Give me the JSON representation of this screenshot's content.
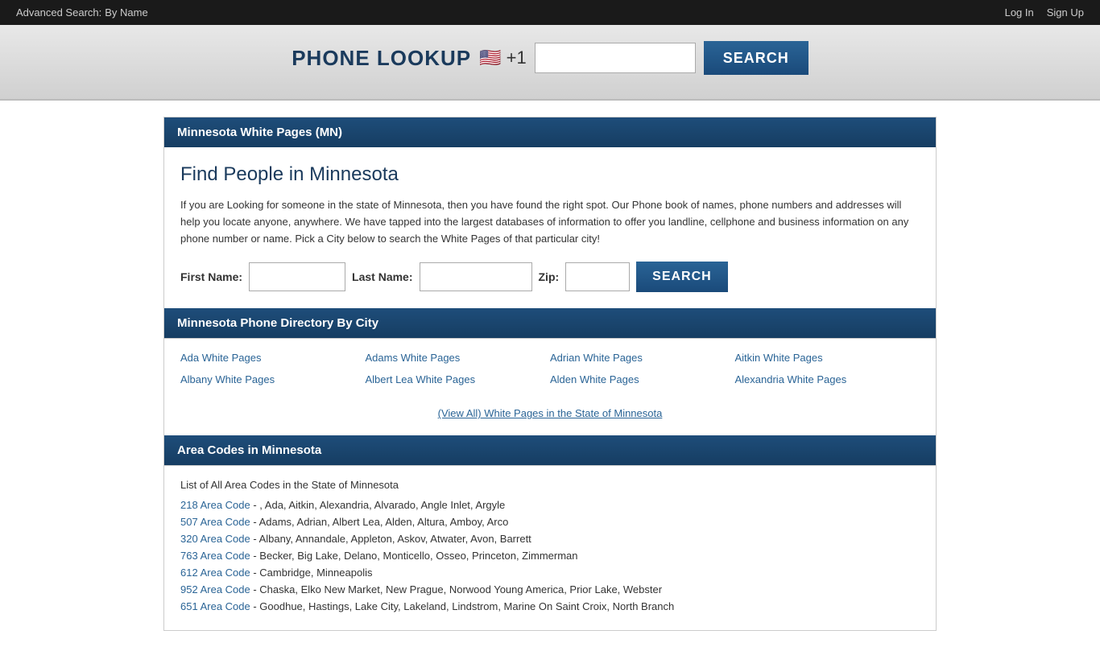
{
  "topBar": {
    "advancedSearch": "Advanced Search:",
    "byNameLabel": "By Name",
    "loginLabel": "Log In",
    "signupLabel": "Sign Up"
  },
  "phoneLookup": {
    "title": "PHONE LOOKUP",
    "flag": "🇺🇸",
    "countryCode": "+1",
    "inputPlaceholder": "",
    "searchLabel": "SEARCH"
  },
  "mainSection": {
    "headerTitle": "Minnesota White Pages (MN)",
    "findPeopleTitle": "Find People in Minnesota",
    "description": "If you are Looking for someone in the state of Minnesota, then you have found the right spot. Our Phone book of names, phone numbers and addresses will help you locate anyone, anywhere. We have tapped into the largest databases of information to offer you landline, cellphone and business information on any phone number or name. Pick a City below to search the White Pages of that particular city!",
    "form": {
      "firstNameLabel": "First Name:",
      "lastNameLabel": "Last Name:",
      "zipLabel": "Zip:",
      "searchLabel": "SEARCH"
    },
    "directoryHeader": "Minnesota Phone Directory By City",
    "cityLinks": [
      {
        "label": "Ada White Pages",
        "href": "#"
      },
      {
        "label": "Adams White Pages",
        "href": "#"
      },
      {
        "label": "Adrian White Pages",
        "href": "#"
      },
      {
        "label": "Aitkin White Pages",
        "href": "#"
      },
      {
        "label": "Albany White Pages",
        "href": "#"
      },
      {
        "label": "Albert Lea White Pages",
        "href": "#"
      },
      {
        "label": "Alden White Pages",
        "href": "#"
      },
      {
        "label": "Alexandria White Pages",
        "href": "#"
      }
    ],
    "viewAllLabel": "(View All) White Pages in the State of Minnesota",
    "areaCodesHeader": "Area Codes in Minnesota",
    "areaCodesTitle": "List of All Area Codes in the State of Minnesota",
    "areaCodes": [
      {
        "code": "218 Area Code",
        "href": "#",
        "description": "- , Ada, Aitkin, Alexandria, Alvarado, Angle Inlet, Argyle"
      },
      {
        "code": "507 Area Code",
        "href": "#",
        "description": "- Adams, Adrian, Albert Lea, Alden, Altura, Amboy, Arco"
      },
      {
        "code": "320 Area Code",
        "href": "#",
        "description": "- Albany, Annandale, Appleton, Askov, Atwater, Avon, Barrett"
      },
      {
        "code": "763 Area Code",
        "href": "#",
        "description": "- Becker, Big Lake, Delano, Monticello, Osseo, Princeton, Zimmerman"
      },
      {
        "code": "612 Area Code",
        "href": "#",
        "description": "- Cambridge, Minneapolis"
      },
      {
        "code": "952 Area Code",
        "href": "#",
        "description": "- Chaska, Elko New Market, New Prague, Norwood Young America, Prior Lake, Webster"
      },
      {
        "code": "651 Area Code",
        "href": "#",
        "description": "- Goodhue, Hastings, Lake City, Lakeland, Lindstrom, Marine On Saint Croix, North Branch"
      }
    ]
  }
}
